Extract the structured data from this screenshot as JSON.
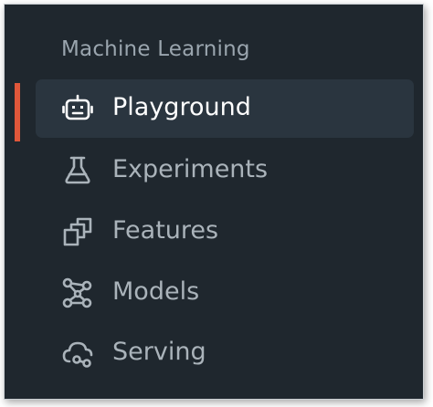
{
  "sidebar": {
    "section_title": "Machine Learning",
    "items": [
      {
        "label": "Playground",
        "icon": "robot-icon",
        "active": true
      },
      {
        "label": "Experiments",
        "icon": "flask-icon",
        "active": false
      },
      {
        "label": "Features",
        "icon": "stacked-squares-icon",
        "active": false
      },
      {
        "label": "Models",
        "icon": "nodes-icon",
        "active": false
      },
      {
        "label": "Serving",
        "icon": "cloud-link-icon",
        "active": false
      }
    ]
  },
  "colors": {
    "background": "#1f272e",
    "active_background": "#2a353f",
    "active_indicator": "#e0573a",
    "text": "#aab3ba",
    "active_text": "#ffffff",
    "section_text": "#9aa5ae"
  }
}
